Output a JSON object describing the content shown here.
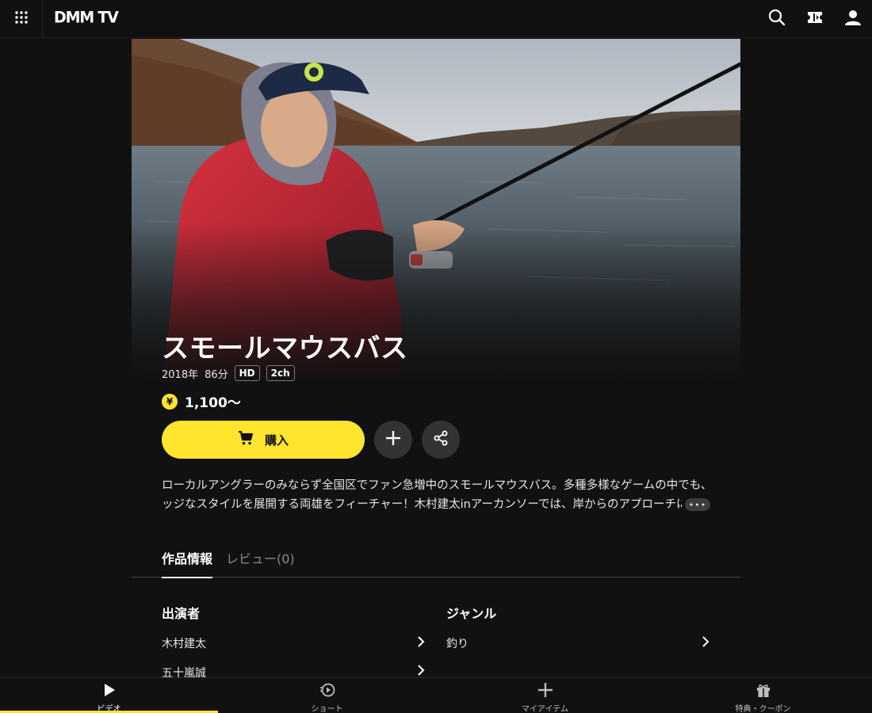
{
  "header": {
    "logo": "DMM TV"
  },
  "video": {
    "title": "スモールマウスバス",
    "year": "2018年",
    "duration": "86分",
    "badges": [
      "HD",
      "2ch"
    ],
    "price_symbol": "¥",
    "price": "1,100〜",
    "buy_label": "購入",
    "description_line1": "ローカルアングラーのみならず全国区でファン急増中のスモールマウスバス。多種多様なゲームの中でも、エ",
    "description_line2": "ッジなスタイルを展開する両雄をフィーチャー！木村建太inアーカンソーでは、岸からのアプローチによる",
    "more_label": "•••"
  },
  "tabs": {
    "info": "作品情報",
    "review": "レビュー(0)"
  },
  "details": {
    "cast_title": "出演者",
    "cast": [
      "木村建太",
      "五十嵐誠"
    ],
    "genre_title": "ジャンル",
    "genres": [
      "釣り"
    ]
  },
  "bottom_nav": [
    {
      "label": "ビデオ",
      "active": true
    },
    {
      "label": "ショート",
      "active": false
    },
    {
      "label": "マイアイテム",
      "active": false
    },
    {
      "label": "特典・クーポン",
      "active": false
    }
  ],
  "colors": {
    "accent": "#ffe52e",
    "background": "#111111",
    "jacket": "#c8283a"
  }
}
